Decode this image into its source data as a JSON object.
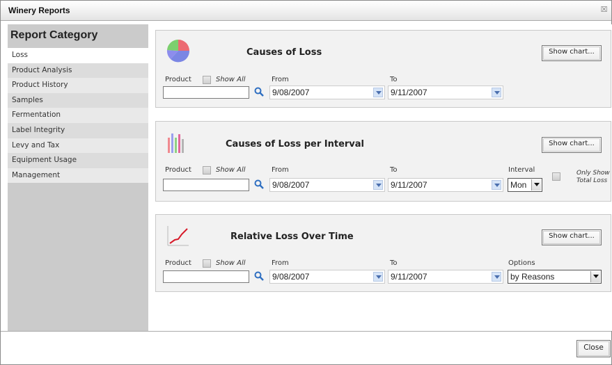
{
  "window": {
    "title": "Winery Reports",
    "close_glyph": "☒"
  },
  "sidebar": {
    "heading": "Report Category",
    "items": [
      {
        "label": "Loss",
        "active": true
      },
      {
        "label": "Product Analysis"
      },
      {
        "label": "Product History"
      },
      {
        "label": "Samples"
      },
      {
        "label": "Fermentation"
      },
      {
        "label": "Label Integrity"
      },
      {
        "label": "Levy and Tax"
      },
      {
        "label": "Equipment Usage"
      },
      {
        "label": "Management"
      }
    ]
  },
  "reports": [
    {
      "title": "Causes of Loss",
      "icon": "pie-chart-icon",
      "show_chart": "Show chart...",
      "product_label": "Product",
      "show_all_label": "Show All",
      "product_value": "",
      "from_label": "From",
      "from_value": "9/08/2007",
      "to_label": "To",
      "to_value": "9/11/2007"
    },
    {
      "title": "Causes of Loss per Interval",
      "icon": "bar-chart-icon",
      "show_chart": "Show chart...",
      "product_label": "Product",
      "show_all_label": "Show All",
      "product_value": "",
      "from_label": "From",
      "from_value": "9/08/2007",
      "to_label": "To",
      "to_value": "9/11/2007",
      "interval_label": "Interval",
      "interval_value": "Mon",
      "only_show_label_1": "Only Show",
      "only_show_label_2": "Total Loss"
    },
    {
      "title": "Relative Loss Over Time",
      "icon": "line-chart-icon",
      "show_chart": "Show chart...",
      "product_label": "Product",
      "show_all_label": "Show All",
      "product_value": "",
      "from_label": "From",
      "from_value": "9/08/2007",
      "to_label": "To",
      "to_value": "9/11/2007",
      "options_label": "Options",
      "options_value": "by Reasons"
    }
  ],
  "footer": {
    "close_label": "Close"
  },
  "colors": {
    "sidebar": "#cbcbcb",
    "panel": "#f2f2f2",
    "accent_arrow": "#4b6fae"
  }
}
